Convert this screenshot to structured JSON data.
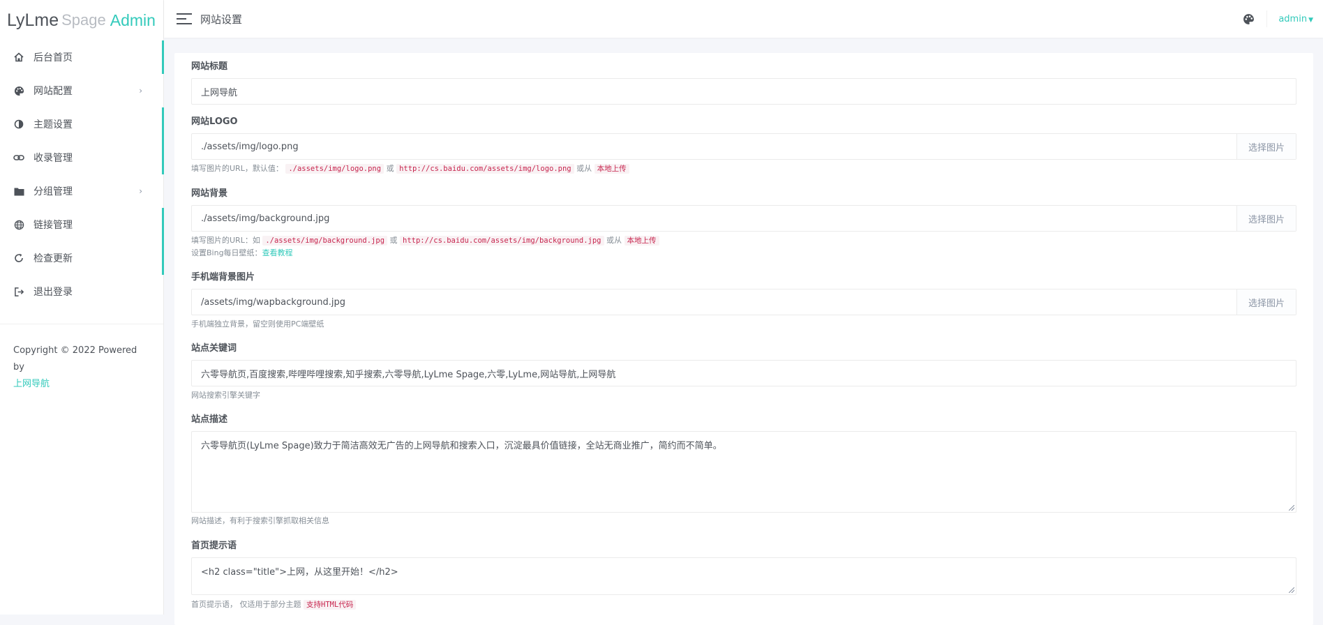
{
  "brand": {
    "part1": "LyLme",
    "part2": "Spage",
    "part3": "Admin"
  },
  "sidebar": {
    "items": [
      {
        "label": "后台首页",
        "icon": "home-icon"
      },
      {
        "label": "网站配置",
        "icon": "palette-icon",
        "has_submenu": true
      },
      {
        "label": "主题设置",
        "icon": "contrast-icon"
      },
      {
        "label": "收录管理",
        "icon": "link-icon"
      },
      {
        "label": "分组管理",
        "icon": "folder-icon",
        "has_submenu": true
      },
      {
        "label": "链接管理",
        "icon": "globe-icon"
      },
      {
        "label": "检查更新",
        "icon": "refresh-icon"
      },
      {
        "label": "退出登录",
        "icon": "logout-icon"
      }
    ],
    "chevron": "›",
    "copyright_text": "Copyright © 2022 Powered by",
    "copyright_link": "上网导航"
  },
  "header": {
    "title": "网站设置",
    "user": "admin"
  },
  "form": {
    "site_title": {
      "label": "网站标题",
      "value": "上网导航"
    },
    "site_logo": {
      "label": "网站LOGO",
      "value": "./assets/img/logo.png",
      "button": "选择图片",
      "help_prefix": "填写图片的URL，默认值：",
      "help_code1": "./assets/img/logo.png",
      "help_or": "或",
      "help_code2": "http://cs.baidu.com/assets/img/logo.png",
      "help_or_from": "或从",
      "help_upload": "本地上传"
    },
    "site_bg": {
      "label": "网站背景",
      "value": "./assets/img/background.jpg",
      "button": "选择图片",
      "help_prefix": "填写图片的URL：如",
      "help_code1": "./assets/img/background.jpg",
      "help_or": "或",
      "help_code2": "http://cs.baidu.com/assets/img/background.jpg",
      "help_or_from": "或从",
      "help_upload": "本地上传",
      "help2_prefix": "设置Bing每日壁纸：",
      "help2_link": "查看教程"
    },
    "mobile_bg": {
      "label": "手机端背景图片",
      "value": "/assets/img/wapbackground.jpg",
      "button": "选择图片",
      "help": "手机端独立背景，留空则使用PC端壁纸"
    },
    "keywords": {
      "label": "站点关键词",
      "value": "六零导航页,百度搜索,哔哩哔哩搜索,知乎搜索,六零导航,LyLme Spage,六零,LyLme,网站导航,上网导航",
      "help": "网站搜索引擎关键字"
    },
    "description": {
      "label": "站点描述",
      "value": "六零导航页(LyLme Spage)致力于简洁高效无广告的上网导航和搜索入口，沉淀最具价值链接，全站无商业推广，简约而不简单。",
      "help": "网站描述，有利于搜索引擎抓取相关信息"
    },
    "tip": {
      "label": "首页提示语",
      "value": "<h2 class=\"title\">上网，从这里开始！</h2>",
      "help_prefix": "首页提示语， 仅适用于部分主题",
      "help_code": "支持HTML代码"
    }
  },
  "colors": {
    "accent": "#33cabb",
    "text": "#4d5259",
    "code": "#c7254e"
  }
}
